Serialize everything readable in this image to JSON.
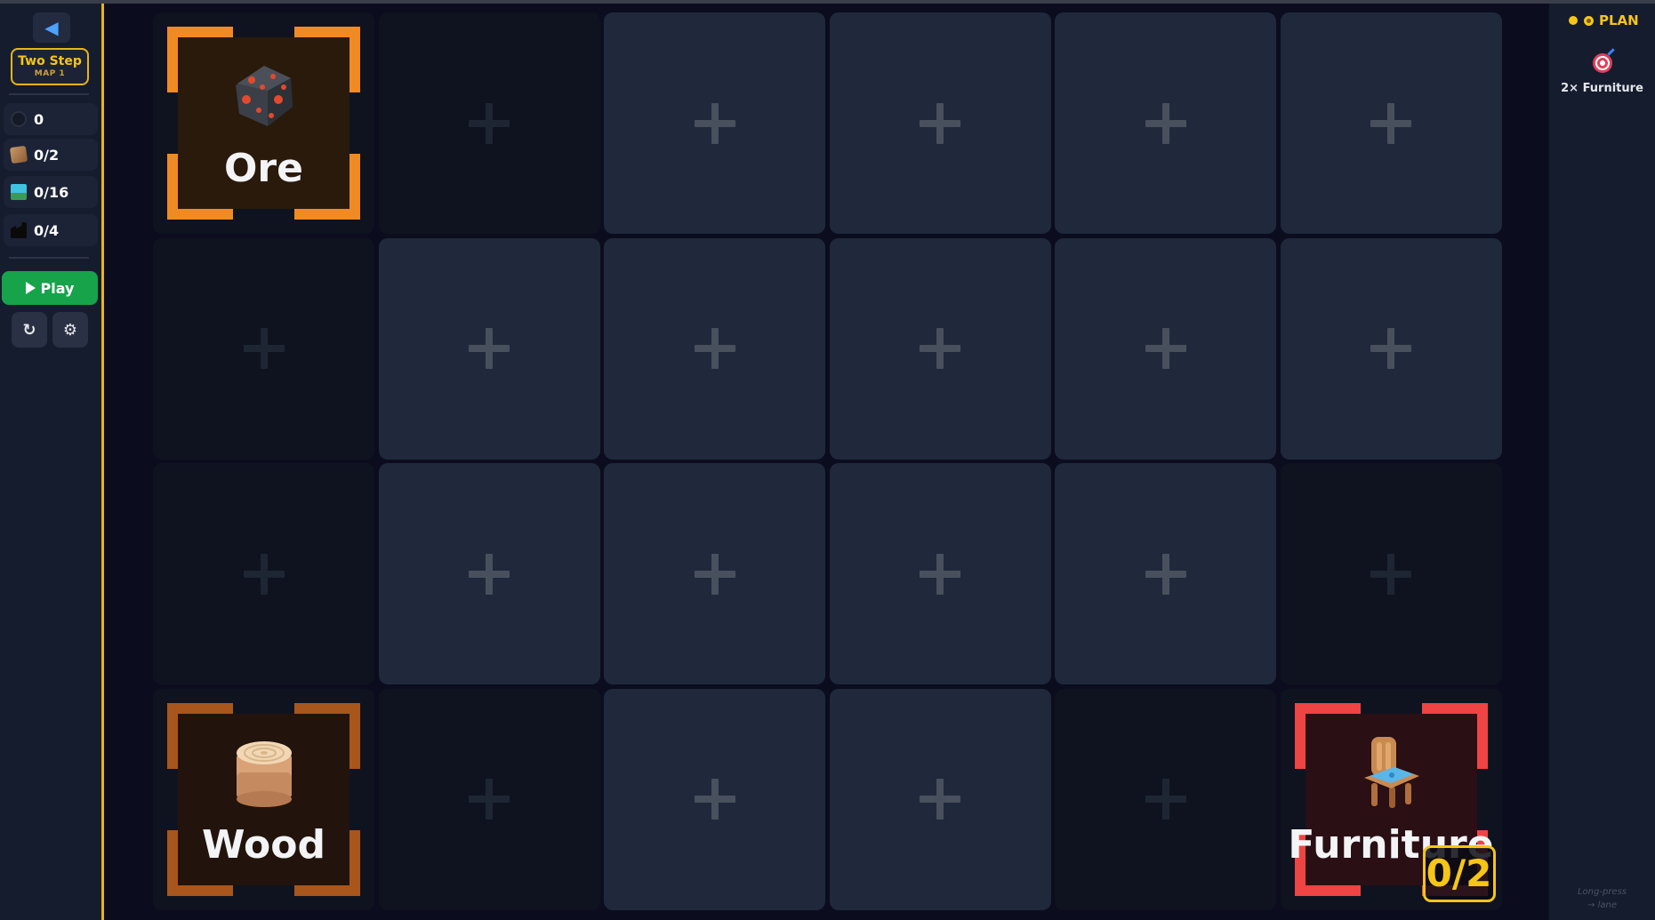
{
  "sidebar": {
    "back_icon": "back-arrow-icon",
    "level_title": "Two Step",
    "level_sub": "MAP 1",
    "stats": [
      {
        "icon": "clock-icon",
        "value": "0"
      },
      {
        "icon": "box-icon",
        "value": "0/2"
      },
      {
        "icon": "tile-icon",
        "value": "0/16"
      },
      {
        "icon": "factory-icon",
        "value": "0/4"
      }
    ],
    "play_label": "Play",
    "reset_glyph": "↻",
    "settings_glyph": "⚙"
  },
  "board": {
    "rows": 4,
    "cols": 6,
    "cells": [
      [
        "node-ore",
        "dark",
        "open",
        "open",
        "open",
        "open"
      ],
      [
        "dark",
        "open",
        "open",
        "open",
        "open",
        "open"
      ],
      [
        "dark",
        "open",
        "open",
        "open",
        "open",
        "dark"
      ],
      [
        "node-wood",
        "dark",
        "open",
        "open",
        "dark",
        "node-furniture"
      ]
    ],
    "nodes": {
      "ore": {
        "label": "Ore",
        "icon": "ore-icon",
        "color": "#f08a24"
      },
      "wood": {
        "label": "Wood",
        "icon": "wood-log-icon",
        "color": "#a8561c"
      },
      "furniture": {
        "label": "Furniture",
        "icon": "chair-icon",
        "color": "#ef4444",
        "count": "0/2"
      }
    }
  },
  "plan": {
    "title": "PLAN",
    "goal_icon": "target-icon",
    "goal_text": "2× Furniture",
    "hint_line1": "Long-press",
    "hint_line2": "→ lane"
  },
  "colors": {
    "accent": "#f5c518",
    "play": "#16a34a",
    "open_cell": "#1f293b",
    "dark_cell": "#0f1320"
  }
}
